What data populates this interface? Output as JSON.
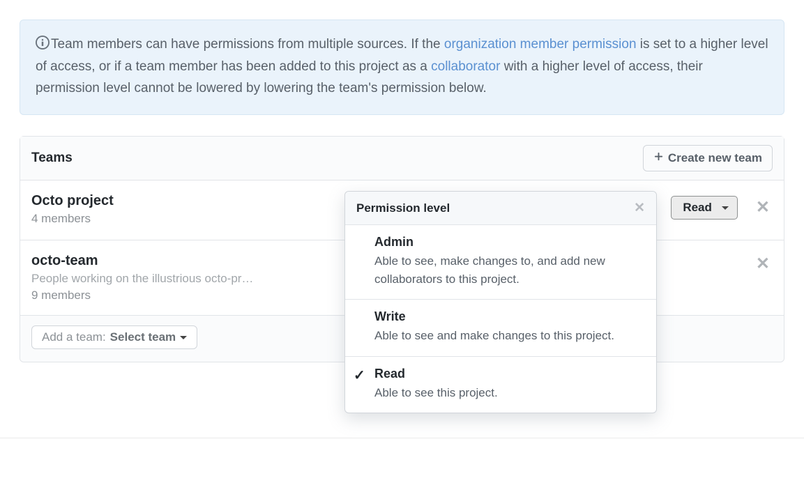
{
  "info": {
    "text_1": "Team members can have permissions from multiple sources. If the ",
    "link_1": "organization member permission",
    "text_2": " is set to a higher level of access, or if a team member has been added to this project as a ",
    "link_2": "collaborator",
    "text_3": " with a higher level of access, their permission level cannot be lowered by lowering the team's permission below."
  },
  "panel": {
    "title": "Teams",
    "create_button": "Create new team"
  },
  "teams": [
    {
      "name": "Octo project",
      "description": "",
      "members": "4 members",
      "permission": "Read"
    },
    {
      "name": "octo-team",
      "description": "People working on the illustrious octo-pr…",
      "members": "9 members",
      "permission": ""
    }
  ],
  "footer": {
    "add_team_label": "Add a team: ",
    "select_team_label": "Select team"
  },
  "popover": {
    "title": "Permission level",
    "options": [
      {
        "title": "Admin",
        "desc": "Able to see, make changes to, and add new collaborators to this project.",
        "selected": false
      },
      {
        "title": "Write",
        "desc": "Able to see and make changes to this project.",
        "selected": false
      },
      {
        "title": "Read",
        "desc": "Able to see this project.",
        "selected": true
      }
    ]
  }
}
